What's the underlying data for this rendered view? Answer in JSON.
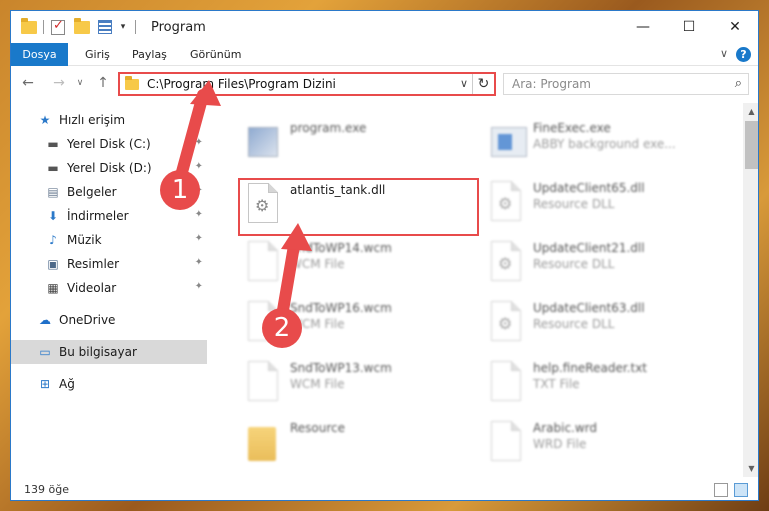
{
  "window": {
    "title": "Program",
    "minimize": "—",
    "maximize": "☐",
    "close": "✕"
  },
  "ribbon": {
    "tabs": [
      "Dosya",
      "Giriş",
      "Paylaş",
      "Görünüm"
    ],
    "chevron": "∨",
    "help": "?"
  },
  "nav": {
    "back": "←",
    "forward": "→",
    "dropdown": "∨",
    "up": "↑",
    "address": "C:\\Program Files\\Program Dizini",
    "address_dropdown": "∨",
    "refresh": "↻",
    "search_placeholder": "Ara: Program",
    "search_icon": "⌕"
  },
  "sidebar": {
    "items": [
      {
        "label": "Hızlı erişim",
        "icon": "star-icon",
        "glyph": "★",
        "color": "#2b79c9",
        "pinned": false,
        "indent": false,
        "selected": false
      },
      {
        "label": "Yerel Disk (C:)",
        "icon": "drive-icon",
        "glyph": "▬",
        "color": "#555555",
        "pinned": true,
        "indent": true,
        "selected": false
      },
      {
        "label": "Yerel Disk (D:)",
        "icon": "drive-icon",
        "glyph": "▬",
        "color": "#555555",
        "pinned": true,
        "indent": true,
        "selected": false
      },
      {
        "label": "Belgeler",
        "icon": "documents-icon",
        "glyph": "▤",
        "color": "#6b7c93",
        "pinned": true,
        "indent": true,
        "selected": false
      },
      {
        "label": "İndirmeler",
        "icon": "downloads-icon",
        "glyph": "⬇",
        "color": "#2b79c9",
        "pinned": true,
        "indent": true,
        "selected": false
      },
      {
        "label": "Müzik",
        "icon": "music-icon",
        "glyph": "♪",
        "color": "#2b79c9",
        "pinned": true,
        "indent": true,
        "selected": false
      },
      {
        "label": "Resimler",
        "icon": "pictures-icon",
        "glyph": "▣",
        "color": "#4d6a8a",
        "pinned": true,
        "indent": true,
        "selected": false
      },
      {
        "label": "Videolar",
        "icon": "videos-icon",
        "glyph": "▦",
        "color": "#444444",
        "pinned": true,
        "indent": true,
        "selected": false
      },
      {
        "label": "OneDrive",
        "icon": "onedrive-icon",
        "glyph": "☁",
        "color": "#1e6fc9",
        "pinned": false,
        "indent": false,
        "selected": false
      },
      {
        "label": "Bu bilgisayar",
        "icon": "computer-icon",
        "glyph": "▭",
        "color": "#2b79c9",
        "pinned": false,
        "indent": false,
        "selected": true
      },
      {
        "label": "Ağ",
        "icon": "network-icon",
        "glyph": "⊞",
        "color": "#2b79c9",
        "pinned": false,
        "indent": false,
        "selected": false
      }
    ],
    "pin_glyph": "📌"
  },
  "files": [
    {
      "name": "program.exe",
      "type": "",
      "kind": "exe",
      "blurred": true
    },
    {
      "name": "FineExec.exe",
      "type": "ABBY background exe...",
      "kind": "app",
      "blurred": true
    },
    {
      "name": "atlantis_tank.dll",
      "type": "",
      "kind": "dll",
      "blurred": false
    },
    {
      "name": "UpdateClient65.dll",
      "type": "Resource DLL",
      "kind": "dll",
      "blurred": true
    },
    {
      "name": "SndToWP14.wcm",
      "type": "WCM File",
      "kind": "doc",
      "blurred": true
    },
    {
      "name": "UpdateClient21.dll",
      "type": "Resource DLL",
      "kind": "dll",
      "blurred": true
    },
    {
      "name": "SndToWP16.wcm",
      "type": "WCM File",
      "kind": "doc",
      "blurred": true
    },
    {
      "name": "UpdateClient63.dll",
      "type": "Resource DLL",
      "kind": "dll",
      "blurred": true
    },
    {
      "name": "SndToWP13.wcm",
      "type": "WCM File",
      "kind": "doc",
      "blurred": true
    },
    {
      "name": "help.fineReader.txt",
      "type": "TXT File",
      "kind": "doc",
      "blurred": true
    },
    {
      "name": "Resource",
      "type": "",
      "kind": "folder",
      "blurred": true
    },
    {
      "name": "Arabic.wrd",
      "type": "WRD File",
      "kind": "doc",
      "blurred": true
    }
  ],
  "scroll": {
    "up": "▲",
    "down": "▼"
  },
  "status": {
    "count_text": "139 öğe"
  },
  "callouts": [
    "1",
    "2"
  ],
  "colors": {
    "accent": "#1979ca",
    "annotation": "#e84b4b"
  }
}
